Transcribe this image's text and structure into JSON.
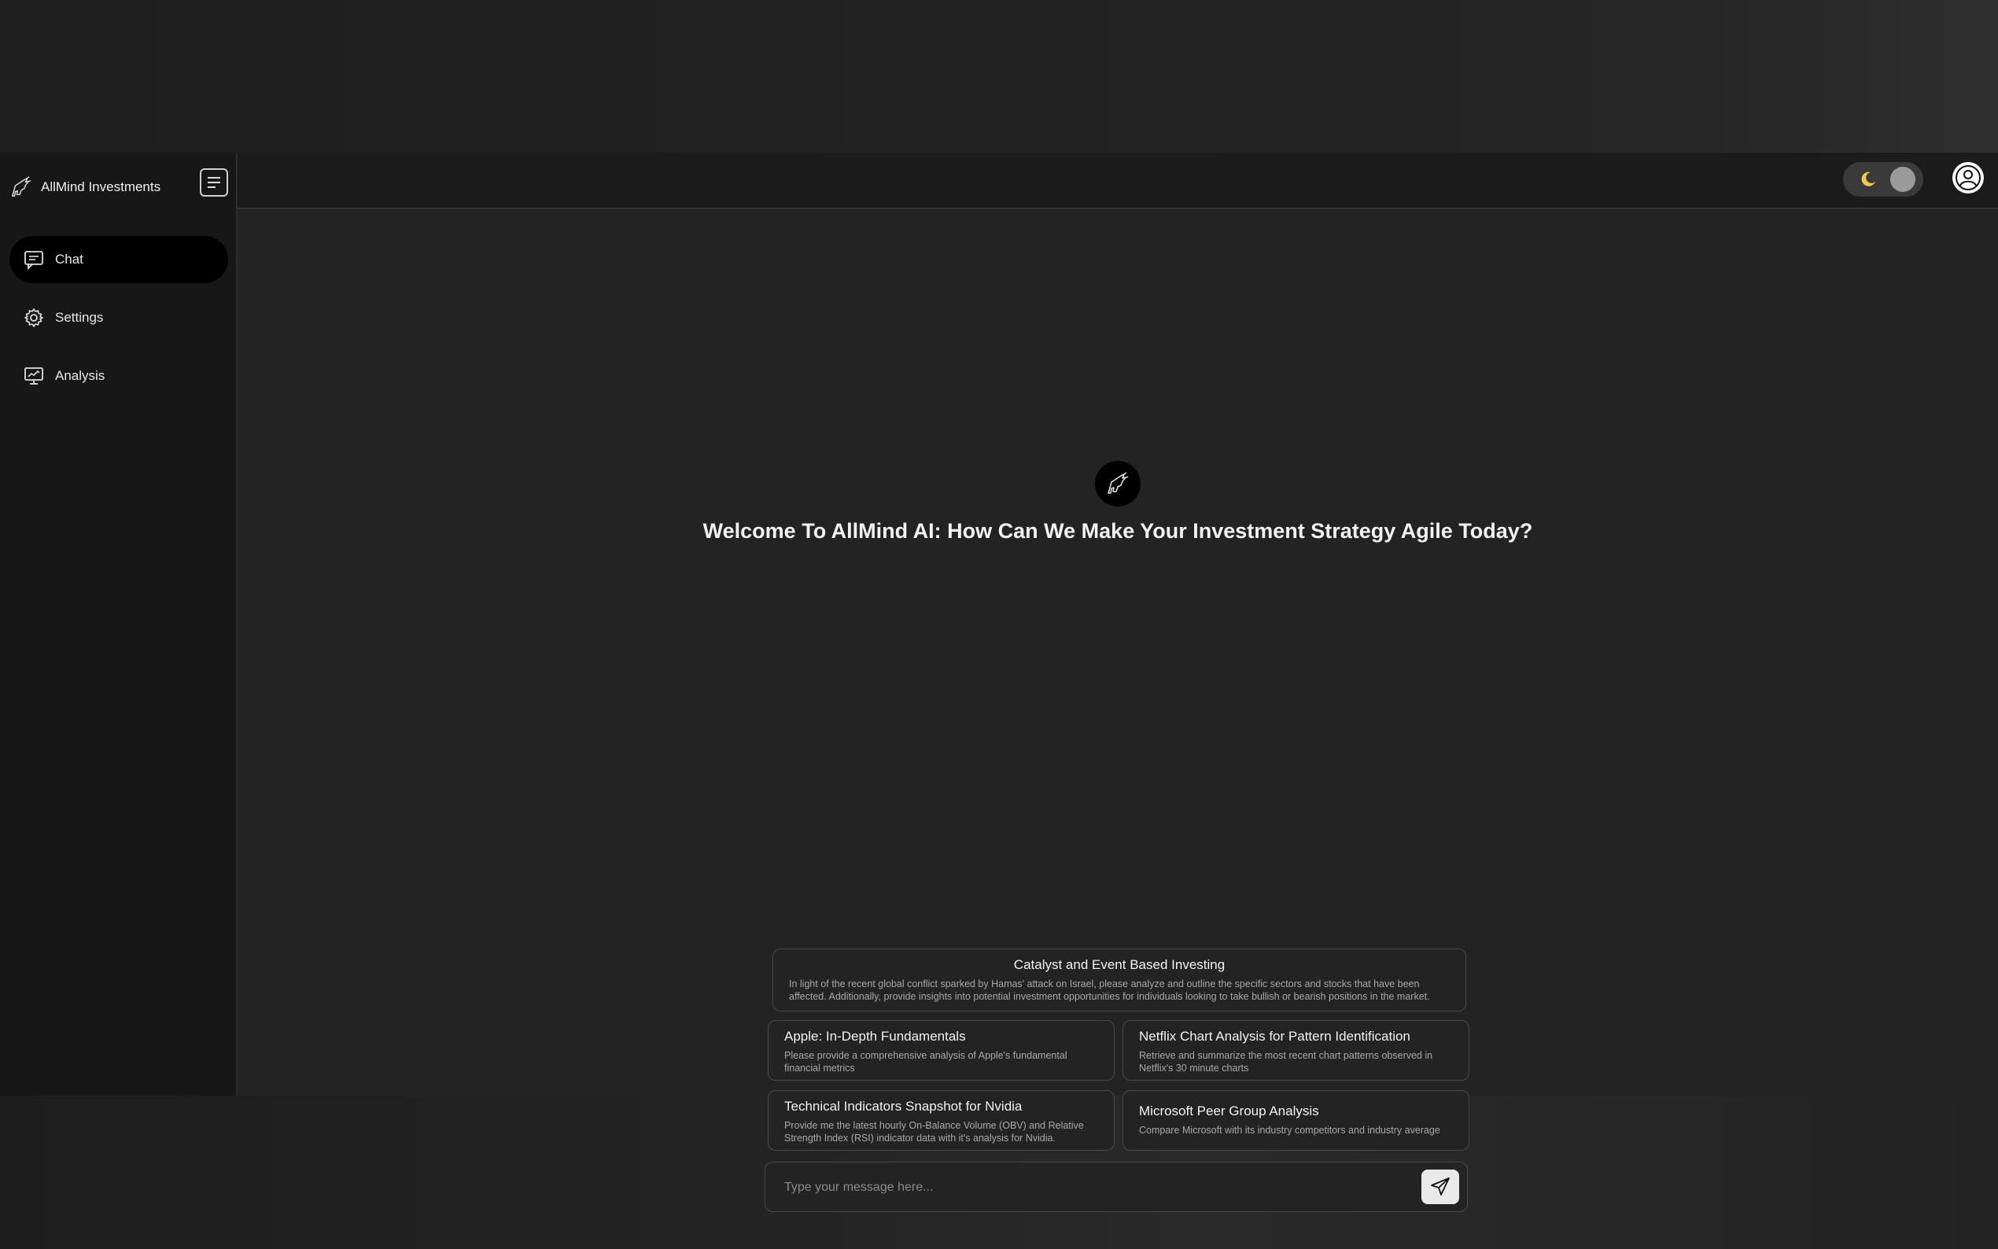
{
  "sidebar": {
    "brand_name": "AllMind Investments",
    "items": [
      {
        "label": "Chat",
        "icon": "chat-icon",
        "active": true
      },
      {
        "label": "Settings",
        "icon": "gear-icon",
        "active": false
      },
      {
        "label": "Analysis",
        "icon": "analysis-monitor-icon",
        "active": false
      }
    ]
  },
  "topbar": {
    "theme_icon": "moon-icon",
    "user_icon": "user-icon"
  },
  "main": {
    "welcome": "Welcome To AllMind AI: How Can We Make Your Investment Strategy Agile Today?",
    "suggestions": [
      {
        "title": "Catalyst and Event Based Investing",
        "desc": "In light of the recent global conflict sparked by Hamas' attack on Israel, please analyze and outline the specific sectors and stocks that have been affected. Additionally, provide insights into potential investment opportunities for individuals looking to take bullish or bearish positions in the market."
      },
      {
        "title": "Apple: In-Depth Fundamentals",
        "desc": "Please provide a comprehensive analysis of Apple's fundamental financial metrics"
      },
      {
        "title": "Netflix Chart Analysis for Pattern Identification",
        "desc": "Retrieve and summarize the most recent chart patterns observed in Netflix's 30 minute charts"
      },
      {
        "title": "Technical Indicators Snapshot for Nvidia",
        "desc": "Provide me the latest hourly On-Balance Volume (OBV) and Relative Strength Index (RSI) indicator data with it's analysis for Nvidia."
      },
      {
        "title": "Microsoft Peer Group Analysis",
        "desc": "Compare Microsoft with its industry competitors and industry average"
      }
    ],
    "composer": {
      "placeholder": "Type your message here...",
      "value": ""
    }
  },
  "colors": {
    "background": "#232323",
    "sidebar": "#171717",
    "active_nav": "#000000",
    "moon": "#f2c94c"
  }
}
